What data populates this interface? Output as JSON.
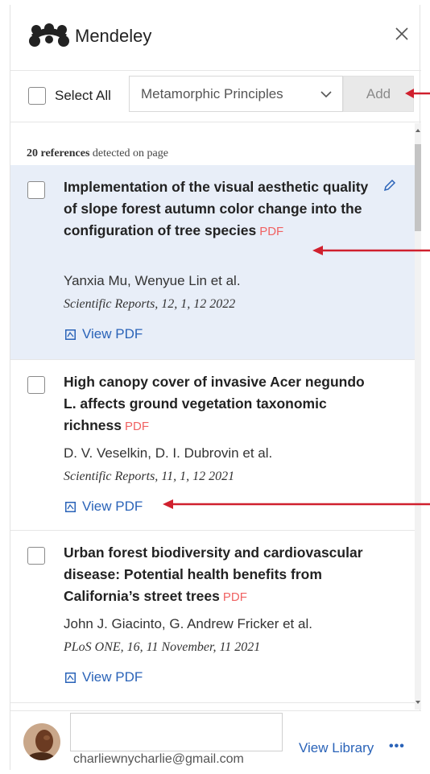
{
  "header": {
    "brand": "Mendeley",
    "logo_icon": "mendeley-logo-icon",
    "close_icon": "close-icon"
  },
  "toolbar": {
    "select_all_label": "Select All",
    "collection_value": "Metamorphic Principles",
    "add_label": "Add"
  },
  "list": {
    "count_bold": "20 references",
    "count_rest": " detected on page",
    "references": [
      {
        "title": "Implementation of the visual aesthetic quality of slope forest autumn color change into the configuration of tree species",
        "pdf_tag": "PDF",
        "authors": "Yanxia Mu, Wenyue Lin et al.",
        "journal": "Scientific Reports, 12, 1, 12 2022",
        "view_pdf": "View PDF",
        "selected": true
      },
      {
        "title": "High canopy cover of invasive Acer negundo L. affects ground vegetation taxonomic richness",
        "pdf_tag": "PDF",
        "authors": "D. V. Veselkin, D. I. Dubrovin et al.",
        "journal": "Scientific Reports, 11, 1, 12 2021",
        "view_pdf": "View PDF",
        "selected": false
      },
      {
        "title": "Urban forest biodiversity and cardiovascular disease: Potential health benefits from California’s street trees",
        "pdf_tag": "PDF",
        "authors": "John J. Giacinto, G. Andrew Fricker et al.",
        "journal": "PLoS ONE, 16, 11 November, 11 2021",
        "view_pdf": "View PDF",
        "selected": false
      }
    ]
  },
  "footer": {
    "email": "charliewnycharlie@gmail.com",
    "view_library": "View Library",
    "more": "•••"
  },
  "colors": {
    "link": "#2a63b8",
    "pdf_tag": "#f06262",
    "selected_bg": "#e8eef8",
    "annotation_arrow": "#d0202e"
  }
}
